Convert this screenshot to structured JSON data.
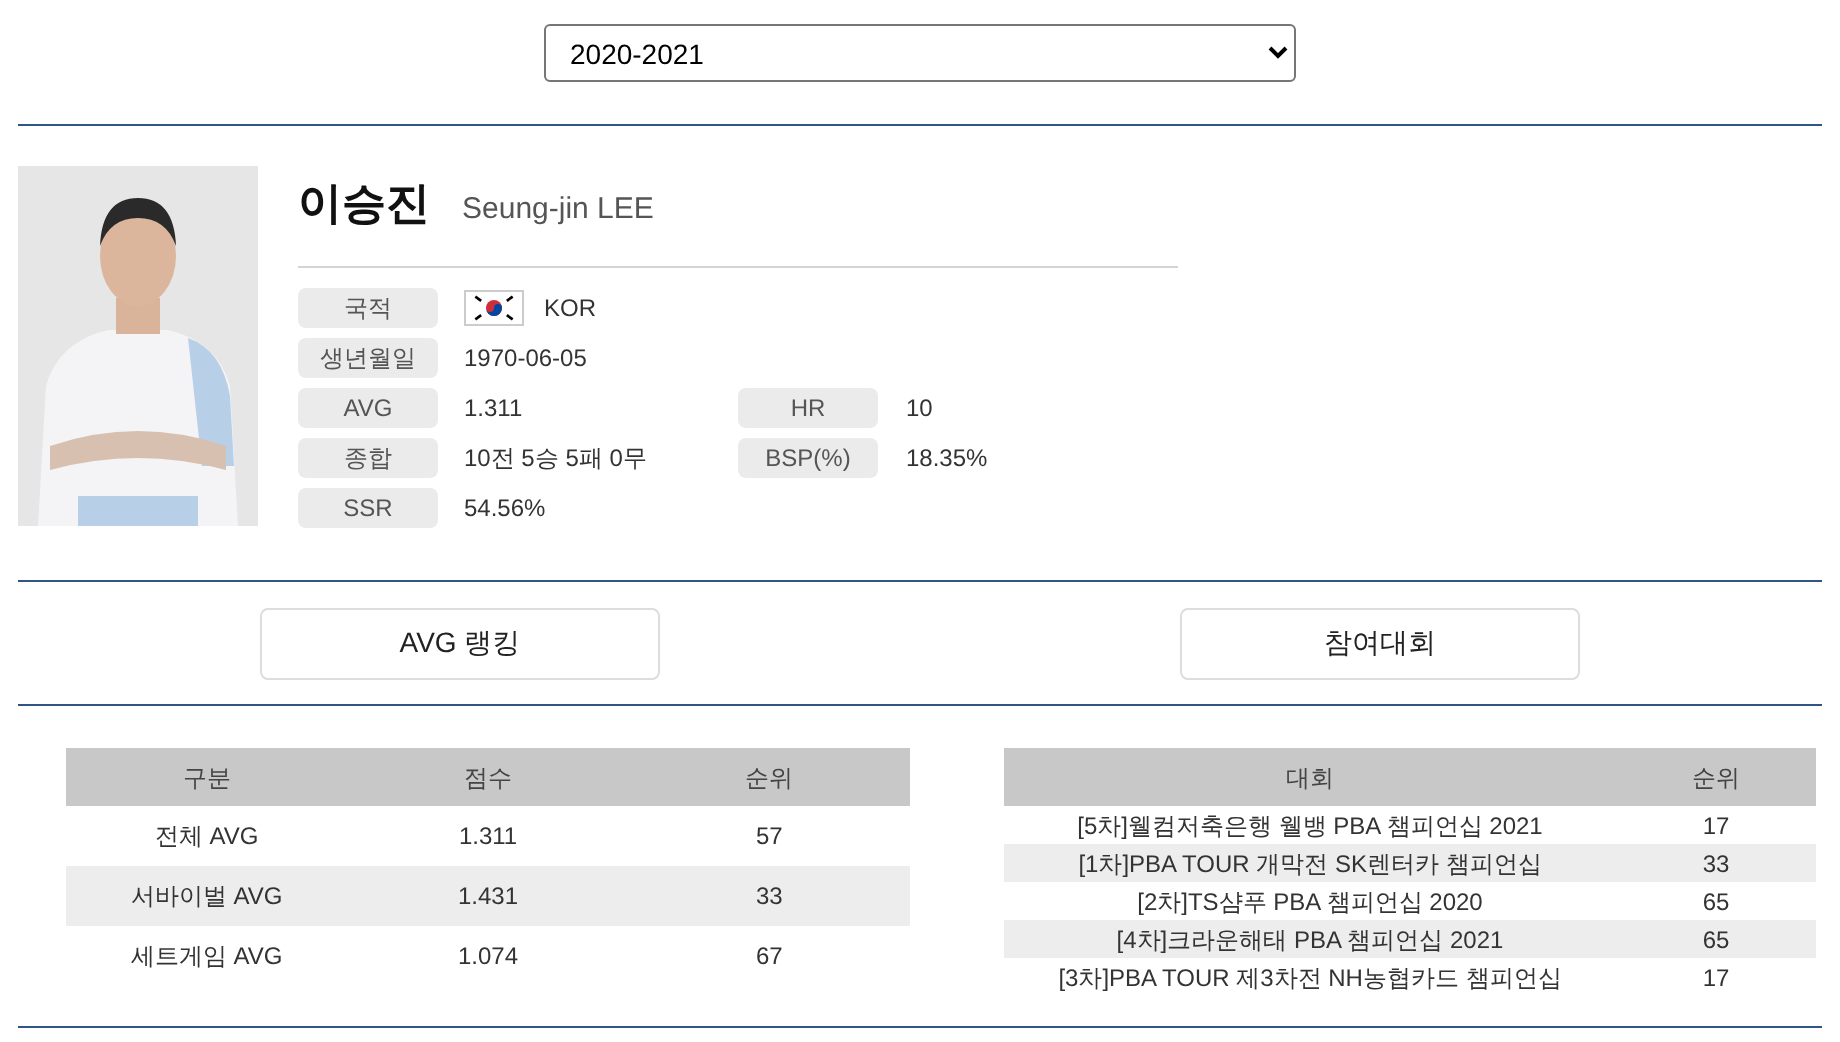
{
  "season_select": {
    "value": "2020-2021"
  },
  "player": {
    "name_ko": "이승진",
    "name_en": "Seung-jin LEE",
    "info": [
      {
        "label": "국적",
        "value": "KOR",
        "flag": true
      },
      {
        "label": "생년월일",
        "value": "1970-06-05"
      },
      {
        "label": "AVG",
        "value": "1.311",
        "label2": "HR",
        "value2": "10"
      },
      {
        "label": "종합",
        "value": "10전 5승 5패 0무",
        "label2": "BSP(%)",
        "value2": "18.35%"
      },
      {
        "label": "SSR",
        "value": "54.56%"
      }
    ]
  },
  "section_buttons": [
    "AVG 랭킹",
    "참여대회"
  ],
  "ranking_table": {
    "columns": [
      "구분",
      "점수",
      "순위"
    ],
    "rows": [
      [
        "전체 AVG",
        "1.311",
        "57"
      ],
      [
        "서바이벌 AVG",
        "1.431",
        "33"
      ],
      [
        "세트게임 AVG",
        "1.074",
        "67"
      ]
    ]
  },
  "tournament_table": {
    "columns": [
      "대회",
      "순위"
    ],
    "rows": [
      [
        "[5차]웰컴저축은행 웰뱅 PBA 챔피언십 2021",
        "17"
      ],
      [
        "[1차]PBA TOUR 개막전 SK렌터카 챔피언십",
        "33"
      ],
      [
        "[2차]TS샴푸 PBA 챔피언십 2020",
        "65"
      ],
      [
        "[4차]크라운해태 PBA 챔피언십 2021",
        "65"
      ],
      [
        "[3차]PBA TOUR 제3차전 NH농협카드 챔피언십",
        "17"
      ]
    ]
  }
}
